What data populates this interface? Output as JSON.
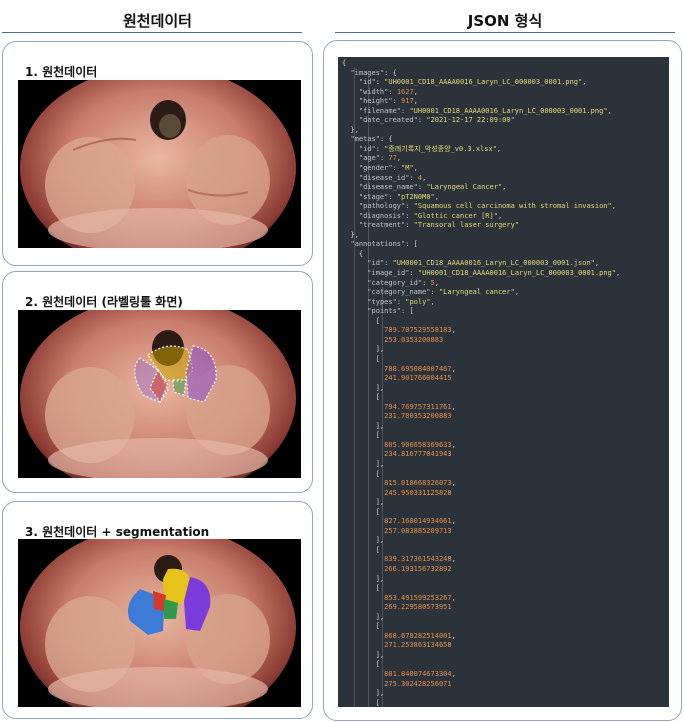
{
  "left_column": {
    "title": "원천데이터"
  },
  "right_column": {
    "title": "JSON 형식"
  },
  "cards": [
    {
      "title": "1. 원천데이터"
    },
    {
      "title": "2. 원천데이터 (라벨링툴 화면)"
    },
    {
      "title": "3. 원천데이터 + segmentation"
    }
  ],
  "json_lines": [
    "{",
    "  \"images\": {",
    "    \"id\": \"UH0001_CD18_AAAA0016_Laryn_LC_000003_0001.png\",",
    "    \"width\": 1627,",
    "    \"height\": 917,",
    "    \"filename\": \"UH0001_CD18_AAAA0016_Laryn_LC_000003_0001.png\",",
    "    \"date_created\": \"2021-12-17 22:09:00\"",
    "  },",
    "  \"metas\": {",
    "    \"id\": \"증례기록지_악성종양_v0.3.xlsx\",",
    "    \"age\": 77,",
    "    \"gender\": \"M\",",
    "    \"disease_id\": 4,",
    "    \"disease_name\": \"Laryngeal Cancer\",",
    "    \"stage\": \"pT2N0M0\",",
    "    \"pathology\": \"Squamous cell carcinoma with stromal invasion\",",
    "    \"diagnosis\": \"Glottic cancer [R]\",",
    "    \"treatment\": \"Transoral laser surgery\"",
    "  },",
    "  \"annotations\": [",
    "    {",
    "      \"id\": \"UH0001_CD18_AAAA0016_Laryn_LC_000003_0001.json\",",
    "      \"image_id\": \"UH0001_CD18_AAAA0016_Laryn_LC_000003_0001.png\",",
    "      \"category_id\": 5,",
    "      \"category_name\": \"Laryngeal cancer\",",
    "      \"types\": \"poly\",",
    "      \"points\": [",
    "        [",
    "          789.707529558183,",
    "          253.0353200883",
    "        ],",
    "        [",
    "          788.695084007467,",
    "          241.901766004415",
    "        ],",
    "        [",
    "          794.769757311761,",
    "          231.780353200883",
    "        ],",
    "        [",
    "          805.906658369633,",
    "          234.816777041943",
    "        ],",
    "        [",
    "          815.018668326073,",
    "          245.950331125828",
    "        ],",
    "        [",
    "          827.168014934661,",
    "          257.083885209713",
    "        ],",
    "        [",
    "          839.317361543248,",
    "          266.193156732892",
    "        ],",
    "        [",
    "          853.491599253267,",
    "          269.229580573951",
    "        ],",
    "        [",
    "          868.678282514001,",
    "          271.253863134658",
    "        ],",
    "        [",
    "          881.840074673304,",
    "          275.302428256071",
    "        ],",
    "        ["
  ],
  "colors": {
    "accent_rule": "#4a6a9a",
    "card_border": "#8fa6c8",
    "code_background": "#2b323a",
    "code_string": "#e6db74",
    "code_number": "#e6904a",
    "segmentation": [
      "#3d7bd6",
      "#e6c21a",
      "#7a3ddc",
      "#2e9a4a",
      "#d43a2a"
    ]
  }
}
